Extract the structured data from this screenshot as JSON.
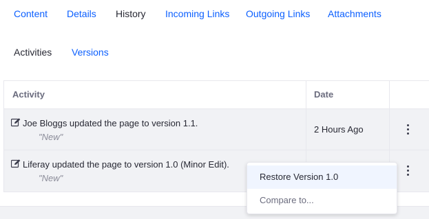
{
  "tabs": [
    {
      "label": "Content",
      "active": false
    },
    {
      "label": "Details",
      "active": false
    },
    {
      "label": "History",
      "active": true
    },
    {
      "label": "Incoming Links",
      "active": false
    },
    {
      "label": "Outgoing Links",
      "active": false
    },
    {
      "label": "Attachments",
      "active": false
    }
  ],
  "subtabs": [
    {
      "label": "Activities",
      "active": true
    },
    {
      "label": "Versions",
      "active": false
    }
  ],
  "table": {
    "headers": {
      "activity": "Activity",
      "date": "Date"
    },
    "rows": [
      {
        "icon": "edit-icon",
        "activity": "Joe Bloggs updated the page to version 1.1.",
        "summary": "\"New\"",
        "date": "2 Hours Ago"
      },
      {
        "icon": "edit-icon",
        "activity": "Liferay updated the page to version 1.0 (Minor Edit).",
        "summary": "\"New\"",
        "date": ""
      }
    ]
  },
  "dropdown": {
    "items": [
      {
        "label": "Restore Version 1.0",
        "highlighted": true
      },
      {
        "label": "Compare to...",
        "highlighted": false
      }
    ]
  },
  "colors": {
    "link": "#0b5fff",
    "text": "#272833",
    "muted": "#6b6c7e",
    "row_bg": "#f1f2f5"
  }
}
